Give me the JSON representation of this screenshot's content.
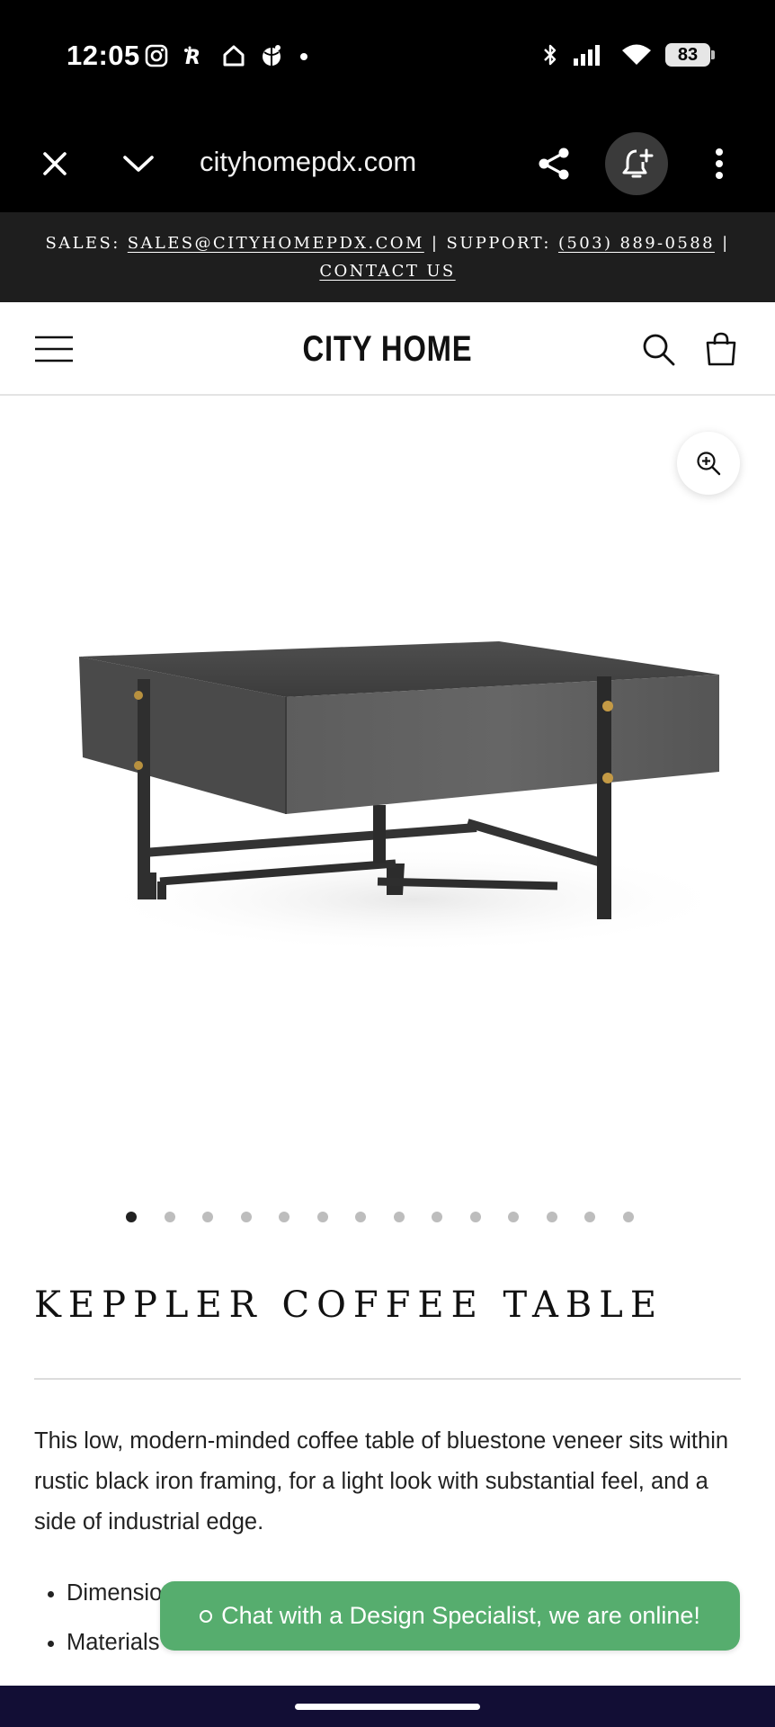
{
  "status_bar": {
    "time": "12:05",
    "battery": "83"
  },
  "browser": {
    "url": "cityhomepdx.com"
  },
  "announcement": {
    "sales_prefix": "SALES:",
    "sales_email": "SALES@CITYHOMEPDX.COM",
    "support_prefix": "| SUPPORT:",
    "support_phone": "(503) 889-0588",
    "separator": "|",
    "contact_label": "CONTACT US"
  },
  "header": {
    "logo": "CITY HOME"
  },
  "gallery": {
    "slide_count": 14,
    "active_index": 0
  },
  "product": {
    "title": "KEPPLER COFFEE TABLE",
    "description": "This low, modern-minded coffee table of bluestone veneer sits within rustic black iron framing, for a light look with substantial feel, and a side of industrial edge.",
    "specs": [
      "Dimensio",
      "Materials"
    ]
  },
  "chat": {
    "label": "Chat with a Design Specialist, we are online!"
  },
  "colors": {
    "chat_green": "#56ad6e",
    "announcement_bg": "#1e1e1e",
    "nav_bar": "#120e35"
  }
}
